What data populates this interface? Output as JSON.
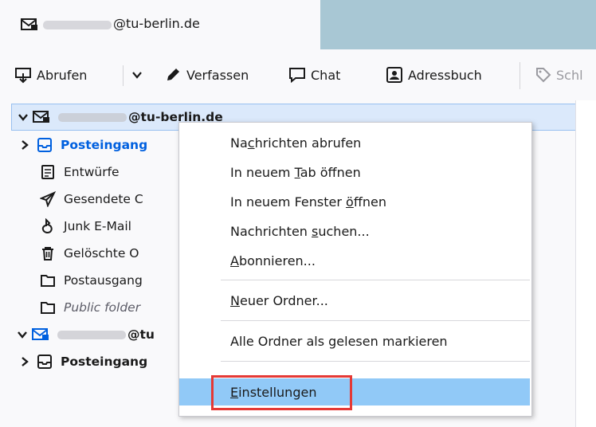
{
  "tab": {
    "email": "@tu-berlin.de"
  },
  "toolbar": {
    "abrufen": "Abrufen",
    "verfassen": "Verfassen",
    "chat": "Chat",
    "adressbuch": "Adressbuch",
    "schlagworte": "Schl"
  },
  "folders": {
    "account1": "@tu-berlin.de",
    "posteingang": "Posteingang",
    "entwuerfe": "Entwürfe",
    "gesendete": "Gesendete C",
    "junk": "Junk E-Mail",
    "geloeschte": "Gelöschte O",
    "postausgang": "Postausgang",
    "public": "Public folder",
    "account2": "@tu",
    "posteingang2": "Posteingang"
  },
  "menu": {
    "abrufen": {
      "before": "Na",
      "key": "c",
      "after": "hrichten abrufen"
    },
    "tab": {
      "before": "In neuem ",
      "key": "T",
      "after": "ab öffnen"
    },
    "fenster": {
      "before": "In neuem Fenster ",
      "key": "ö",
      "after": "ffnen"
    },
    "suchen": {
      "before": "Nachrichten ",
      "key": "s",
      "after": "uchen..."
    },
    "abonnieren": {
      "before": "",
      "key": "A",
      "after": "bonnieren..."
    },
    "neuer_ordner": {
      "before": "",
      "key": "N",
      "after": "euer Ordner..."
    },
    "alle_gelesen": "Alle Ordner als gelesen markieren",
    "einstellungen": {
      "before": "",
      "key": "E",
      "after": "instellungen"
    }
  },
  "colors": {
    "accent": "#0060df",
    "highlight": "#91c9f7",
    "callout": "#e53935"
  }
}
